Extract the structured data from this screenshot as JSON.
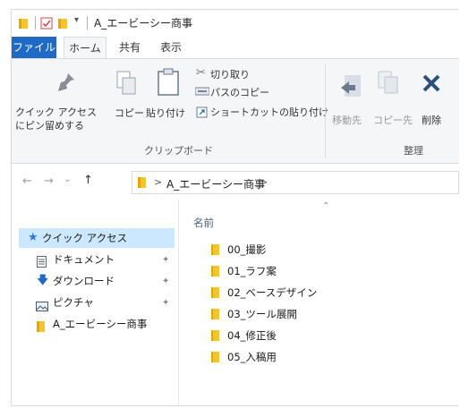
{
  "window": {
    "title": "A_エービーシー商事"
  },
  "ribbon_tabs": [
    {
      "label": "ファイル"
    },
    {
      "label": "ホーム"
    },
    {
      "label": "共有"
    },
    {
      "label": "表示"
    }
  ],
  "ribbon": {
    "clipboard": {
      "pin_quick_access_line1": "クイック アクセス",
      "pin_quick_access_line2": "にピン留めする",
      "copy": "コピー",
      "paste": "貼り付け",
      "cut": "切り取り",
      "copy_path": "パスのコピー",
      "paste_shortcut": "ショートカットの貼り付け",
      "group_name": "クリップボード"
    },
    "organize": {
      "move_to": "移動先",
      "copy_to": "コピー先",
      "delete": "削除",
      "group_name": "整理"
    }
  },
  "address_bar": {
    "separator": ">",
    "current_folder": "A_エービーシー商事",
    "trailing_chevron": ">"
  },
  "nav_pane": {
    "items": [
      {
        "label": "クイック アクセス",
        "icon": "star-icon"
      },
      {
        "label": "ドキュメント",
        "icon": "document-icon"
      },
      {
        "label": "ダウンロード",
        "icon": "download-icon"
      },
      {
        "label": "ピクチャ",
        "icon": "picture-icon"
      },
      {
        "label": "A_エービーシー商事",
        "icon": "folder-icon"
      }
    ]
  },
  "file_list": {
    "column_name": "名前",
    "items": [
      {
        "name": "00_撮影"
      },
      {
        "name": "01_ラフ案"
      },
      {
        "name": "02_ベースデザイン"
      },
      {
        "name": "03_ツール展開"
      },
      {
        "name": "04_修正後"
      },
      {
        "name": "05_入稿用"
      }
    ]
  },
  "colors": {
    "file_tab": "#1f6ac6",
    "selection": "#cce8ff",
    "folder": "#f4c430",
    "delete_x": "#2b4f7a"
  }
}
